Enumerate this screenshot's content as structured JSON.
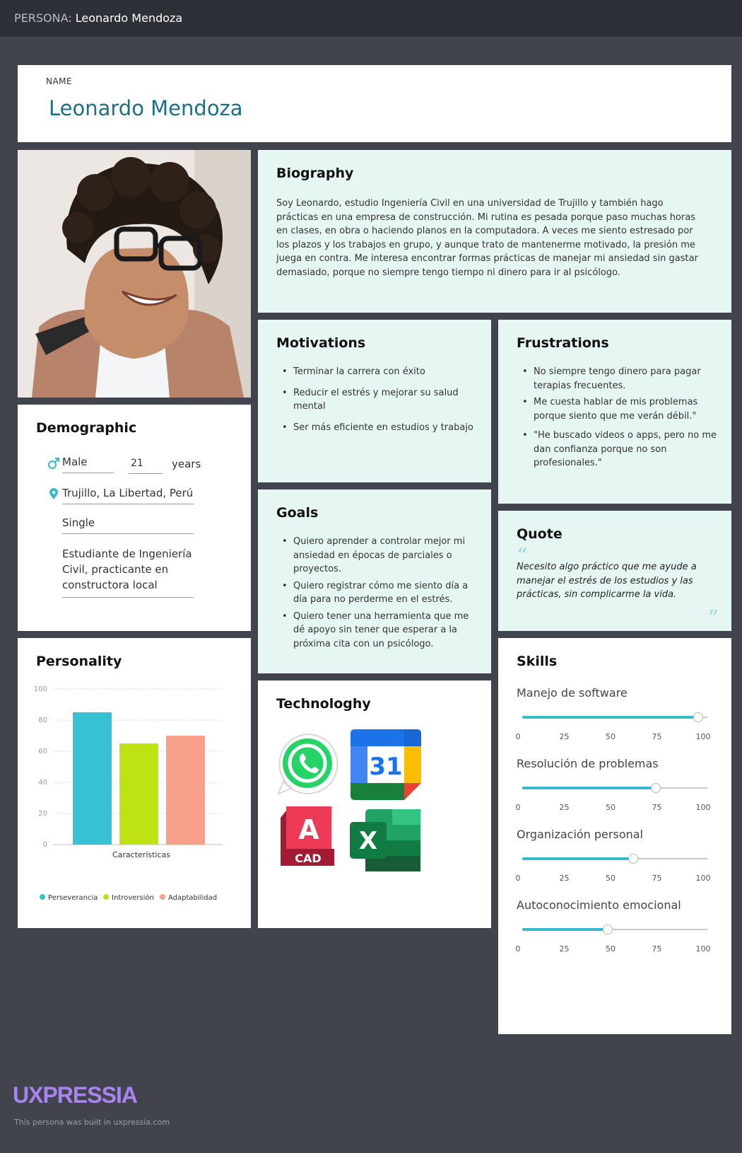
{
  "header": {
    "prefix": "PERSONA:",
    "title": "Leonardo Mendoza"
  },
  "name_section": {
    "label": "NAME",
    "value": "Leonardo Mendoza"
  },
  "biography": {
    "title": "Biography",
    "text": "Soy Leonardo, estudio Ingeniería Civil en una universidad de Trujillo y también hago prácticas en una empresa de construcción. Mi rutina es pesada porque paso muchas horas en clases,  en obra o haciendo planos en la computadora. A veces me siento estresado por los plazos y los trabajos en grupo, y aunque trato de mantenerme motivado, la presión me juega en contra. Me interesa encontrar formas prácticas de manejar mi ansiedad sin gastar demasiado, porque no siempre tengo tiempo ni dinero para ir al psicólogo."
  },
  "motivations": {
    "title": "Motivations",
    "items": [
      "Terminar la carrera con éxito",
      "Reducir el estrés y mejorar su salud mental",
      "Ser más eficiente en estudios y trabajo"
    ]
  },
  "frustrations": {
    "title": "Frustrations",
    "items": [
      "No siempre tengo dinero para pagar terapias frecuentes.",
      "Me cuesta hablar de mis problemas porque siento que me verán débil.\"",
      "\"He buscado videos o apps, pero no me dan confianza porque no son profesionales.\""
    ]
  },
  "goals": {
    "title": "Goals",
    "items": [
      "Quiero aprender a controlar mejor mi ansiedad en épocas de parciales o proyectos.",
      "Quiero registrar cómo me siento día a día para no perderme en el estrés.",
      "Quiero tener una herramienta que me dé apoyo sin tener que esperar a la próxima cita con un psicólogo."
    ]
  },
  "quote": {
    "title": "Quote",
    "open_mark": "“",
    "close_mark": "”",
    "text": "Necesito algo práctico que me ayude a manejar el estrés de los estudios y las prácticas, sin complicarme la vida."
  },
  "demographic": {
    "title": "Demographic",
    "gender": "Male",
    "age": "21",
    "age_unit": "years",
    "location": "Trujillo, La Libertad, Perú",
    "status": "Single",
    "occupation_lines": [
      "Estudiante de Ingeniería",
      "Civil, practicante en",
      "constructora local"
    ],
    "icons": [
      "male-icon",
      "location-pin-icon"
    ]
  },
  "personality": {
    "title": "Personality",
    "chart_data": {
      "type": "bar",
      "categories": [
        "Características"
      ],
      "xlabel": "Características",
      "ylim": [
        0,
        100
      ],
      "yticks": [
        "0",
        "20",
        "40",
        "60",
        "80",
        "100"
      ],
      "grid": true,
      "legend": "bottom",
      "series": [
        {
          "name": "Perseverancia",
          "values": [
            85
          ],
          "color": "#36c2d4"
        },
        {
          "name": "Introversión",
          "values": [
            65
          ],
          "color": "#bde312"
        },
        {
          "name": "Adaptabilidad",
          "values": [
            70
          ],
          "color": "#f8a08a"
        }
      ]
    }
  },
  "technology": {
    "title": "Technologhy",
    "apps": [
      "whatsapp-icon",
      "google-calendar-icon",
      "autocad-icon",
      "excel-icon"
    ],
    "calendar_day": "31",
    "autocad_letter": "A",
    "autocad_label": "CAD",
    "excel_letter": "X",
    "colors": {
      "whatsapp": "#25d366",
      "autocad": "#d8233f",
      "excel": "#1d7a46"
    }
  },
  "skills": {
    "title": "Skills",
    "ticks": [
      "0",
      "25",
      "50",
      "75",
      "100"
    ],
    "accent": "#36b9c8",
    "items": [
      {
        "label": "Manejo de software",
        "value": 95
      },
      {
        "label": "Resolución de problemas",
        "value": 72
      },
      {
        "label": "Organización personal",
        "value": 60
      },
      {
        "label": "Autoconocimiento emocional",
        "value": 46
      }
    ]
  },
  "footer": {
    "brand": "UXPRESSIA",
    "note": "This persona was built in uxpressia.com"
  }
}
